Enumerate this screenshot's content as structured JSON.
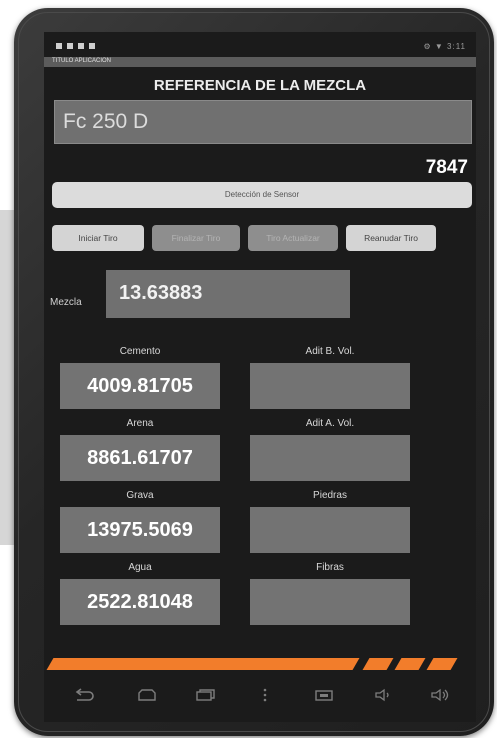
{
  "app": {
    "title": "REFERENCIA DE LA MEZCLA",
    "header_label": "TITULO APLICACION"
  },
  "status_bar": {
    "signal_bars": 4,
    "right_text": "⚙ ▼ 3:11"
  },
  "mix": {
    "value": "Fc 250 D"
  },
  "sample_number": "7847",
  "sensor_button": {
    "label": "Detección de Sensor"
  },
  "buttons": [
    {
      "label": "Iniciar Tiro",
      "enabled": true
    },
    {
      "label": "Finalizar Tiro",
      "enabled": false
    },
    {
      "label": "Tiro Actualizar",
      "enabled": false
    },
    {
      "label": "Reanudar Tiro",
      "enabled": true
    }
  ],
  "mezcla": {
    "label": "Mezcla",
    "value": "13.63883"
  },
  "materials": {
    "cemento": {
      "label": "Cemento",
      "value": "4009.81705"
    },
    "arena": {
      "label": "Arena",
      "value": "8861.61707"
    },
    "grava": {
      "label": "Grava",
      "value": "13975.5069"
    },
    "agua": {
      "label": "Agua",
      "value": "2522.81048"
    }
  },
  "additives": {
    "aditivo_b": {
      "label": "Adit B. Vol.",
      "value": ""
    },
    "aditivo_a": {
      "label": "Adit A. Vol.",
      "value": ""
    },
    "piedras": {
      "label": "Piedras",
      "value": ""
    },
    "fibras": {
      "label": "Fibras",
      "value": ""
    }
  },
  "colors": {
    "accent": "#f27d2b",
    "field_bg": "#707070",
    "screen_bg": "#1b1b1b",
    "button_active": "#d4d4d4",
    "button_disabled": "#8e8e8e"
  },
  "nav_icons": [
    "back-icon",
    "home-icon",
    "recent-apps-icon",
    "menu-icon",
    "screenshot-icon",
    "volume-down-icon",
    "volume-up-icon"
  ]
}
